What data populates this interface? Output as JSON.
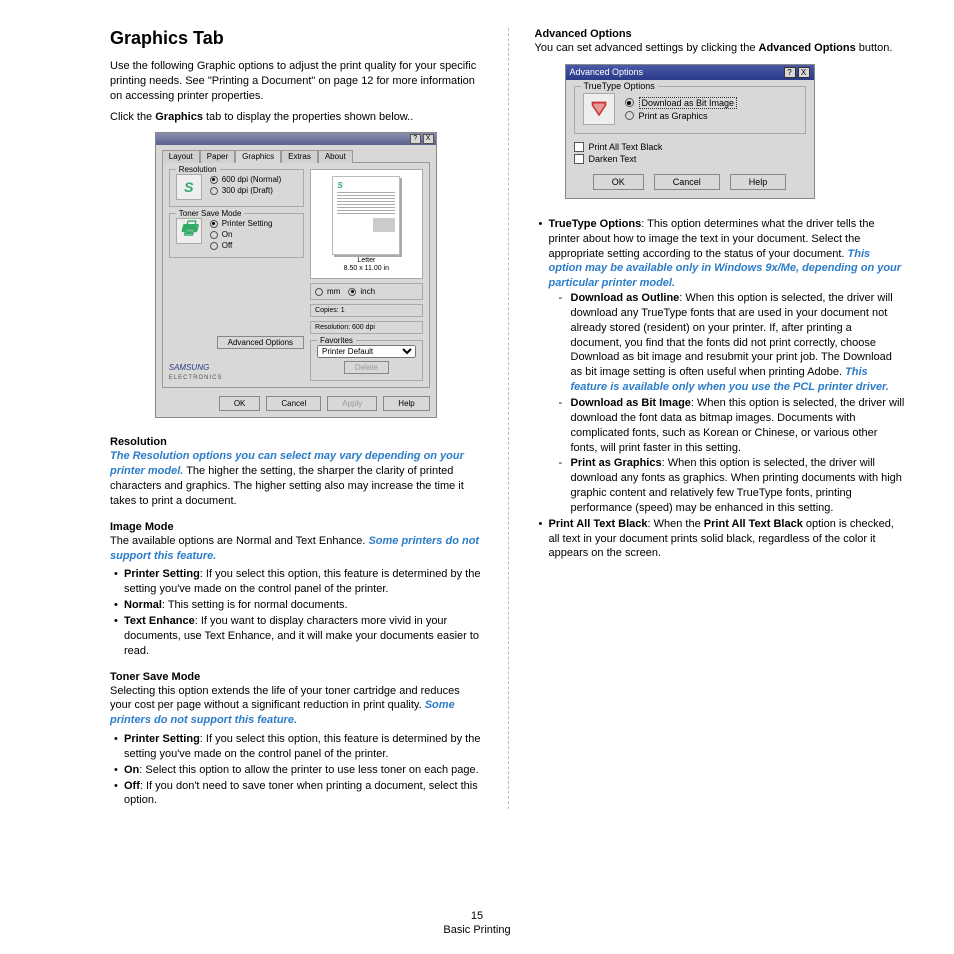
{
  "left": {
    "title": "Graphics Tab",
    "intro1_a": "Use the following Graphic options to adjust the print quality for your specific printing needs. See \"Printing a Document\" on page 12 for more information on accessing printer properties.",
    "intro2_a": "Click the ",
    "intro2_b": "Graphics",
    "intro2_c": " tab to display the properties shown below..",
    "res_hd": "Resolution",
    "res_em": "The Resolution options you can select may vary depending on your printer model.",
    "res_a": " The higher the setting, the sharper the clarity of printed characters and graphics. The higher setting also may increase the time it takes to print a document.",
    "img_hd": "Image Mode",
    "img_a": "The available options are Normal and Text Enhance. ",
    "img_em": "Some printers do not support this feature.",
    "img_li1_b": "Printer Setting",
    "img_li1_t": ": If you select this option, this feature is determined by the setting you've made on the control panel of the printer.",
    "img_li2_b": "Normal",
    "img_li2_t": ": This setting is for normal documents.",
    "img_li3_b": "Text Enhance",
    "img_li3_t": ": If you want to display characters more vivid in your documents, use Text Enhance, and it will make your documents easier to read.",
    "ton_hd": "Toner Save Mode",
    "ton_a": "Selecting this option extends the life of your toner cartridge and reduces your cost per page without a significant reduction in print quality. ",
    "ton_em": "Some printers do not support this feature.",
    "ton_li1_b": "Printer Setting",
    "ton_li1_t": ": If you select this option, this feature is determined by the setting you've made on the control panel of the printer.",
    "ton_li2_b": "On",
    "ton_li2_t": ": Select this option to allow the printer to use less toner on each page.",
    "ton_li3_b": "Off",
    "ton_li3_t": ": If you don't need to save toner when printing a document, select this option."
  },
  "right": {
    "adv_hd": "Advanced Options",
    "adv_a": "You can set advanced settings by clicking the ",
    "adv_b": "Advanced Options",
    "adv_c": " button.",
    "tt_b": "TrueType Options",
    "tt_t": ": This option determines what the driver tells the printer about how to image the text in your document. Select the appropriate setting according to the status of your document. ",
    "tt_em": "This option may be available only in Windows 9x/Me, depending on your particular printer model.",
    "dlo_b": "Download as Outline",
    "dlo_t": ": When this option is selected, the driver will download any TrueType fonts that are used in your document not already stored (resident) on your printer. If, after printing a document, you find that the fonts did not print correctly, choose Download as bit image and resubmit your print job. The Download as bit image setting is often useful when printing Adobe. ",
    "dlo_em": "This feature is available only when you use the PCL printer driver.",
    "dbi_b": "Download as Bit Image",
    "dbi_t": ": When this option is selected, the driver will download the font data as bitmap images. Documents with complicated fonts, such as Korean or Chinese, or various other fonts, will print faster in this setting.",
    "pag_b": "Print as Graphics",
    "pag_t": ": When this option is selected, the driver will download any fonts as graphics. When printing documents with high graphic content and relatively few TrueType fonts, printing performance (speed) may be enhanced in this setting.",
    "patb_b": "Print All Text Black",
    "patb_t1": ": When the ",
    "patb_t2": "Print All Text Black",
    "patb_t3": " option is checked, all text in your document prints solid black, regardless of the color it appears on the screen."
  },
  "dlg1": {
    "tabs": [
      "Layout",
      "Paper",
      "Graphics",
      "Extras",
      "About"
    ],
    "res_legend": "Resolution",
    "res_opt1": "600 dpi (Normal)",
    "res_opt2": "300 dpi (Draft)",
    "ts_legend": "Toner Save Mode",
    "ts_opt1": "Printer Setting",
    "ts_opt2": "On",
    "ts_opt3": "Off",
    "adv_btn": "Advanced Options",
    "logo": "SAMSUNG",
    "logo_sub": "ELECTRONICS",
    "paper": "Letter",
    "papersize": "8.50 x 11.00 in",
    "unit_mm": "mm",
    "unit_inch": "inch",
    "copies": "Copies: 1",
    "resolution": "Resolution: 600 dpi",
    "fav_legend": "Favorites",
    "fav_value": "Printer Default",
    "fav_delete": "Delete",
    "ok": "OK",
    "cancel": "Cancel",
    "apply": "Apply",
    "help": "Help",
    "s": "S"
  },
  "dlg2": {
    "title": "Advanced Options",
    "help_btn": "?",
    "close_btn": "X",
    "tt_legend": "TrueType Options",
    "opt1": "Download as Bit Image",
    "opt2": "Print as Graphics",
    "chk1": "Print All Text Black",
    "chk2": "Darken Text",
    "ok": "OK",
    "cancel": "Cancel",
    "help": "Help"
  },
  "footer": {
    "page": "15",
    "section": "Basic Printing"
  }
}
